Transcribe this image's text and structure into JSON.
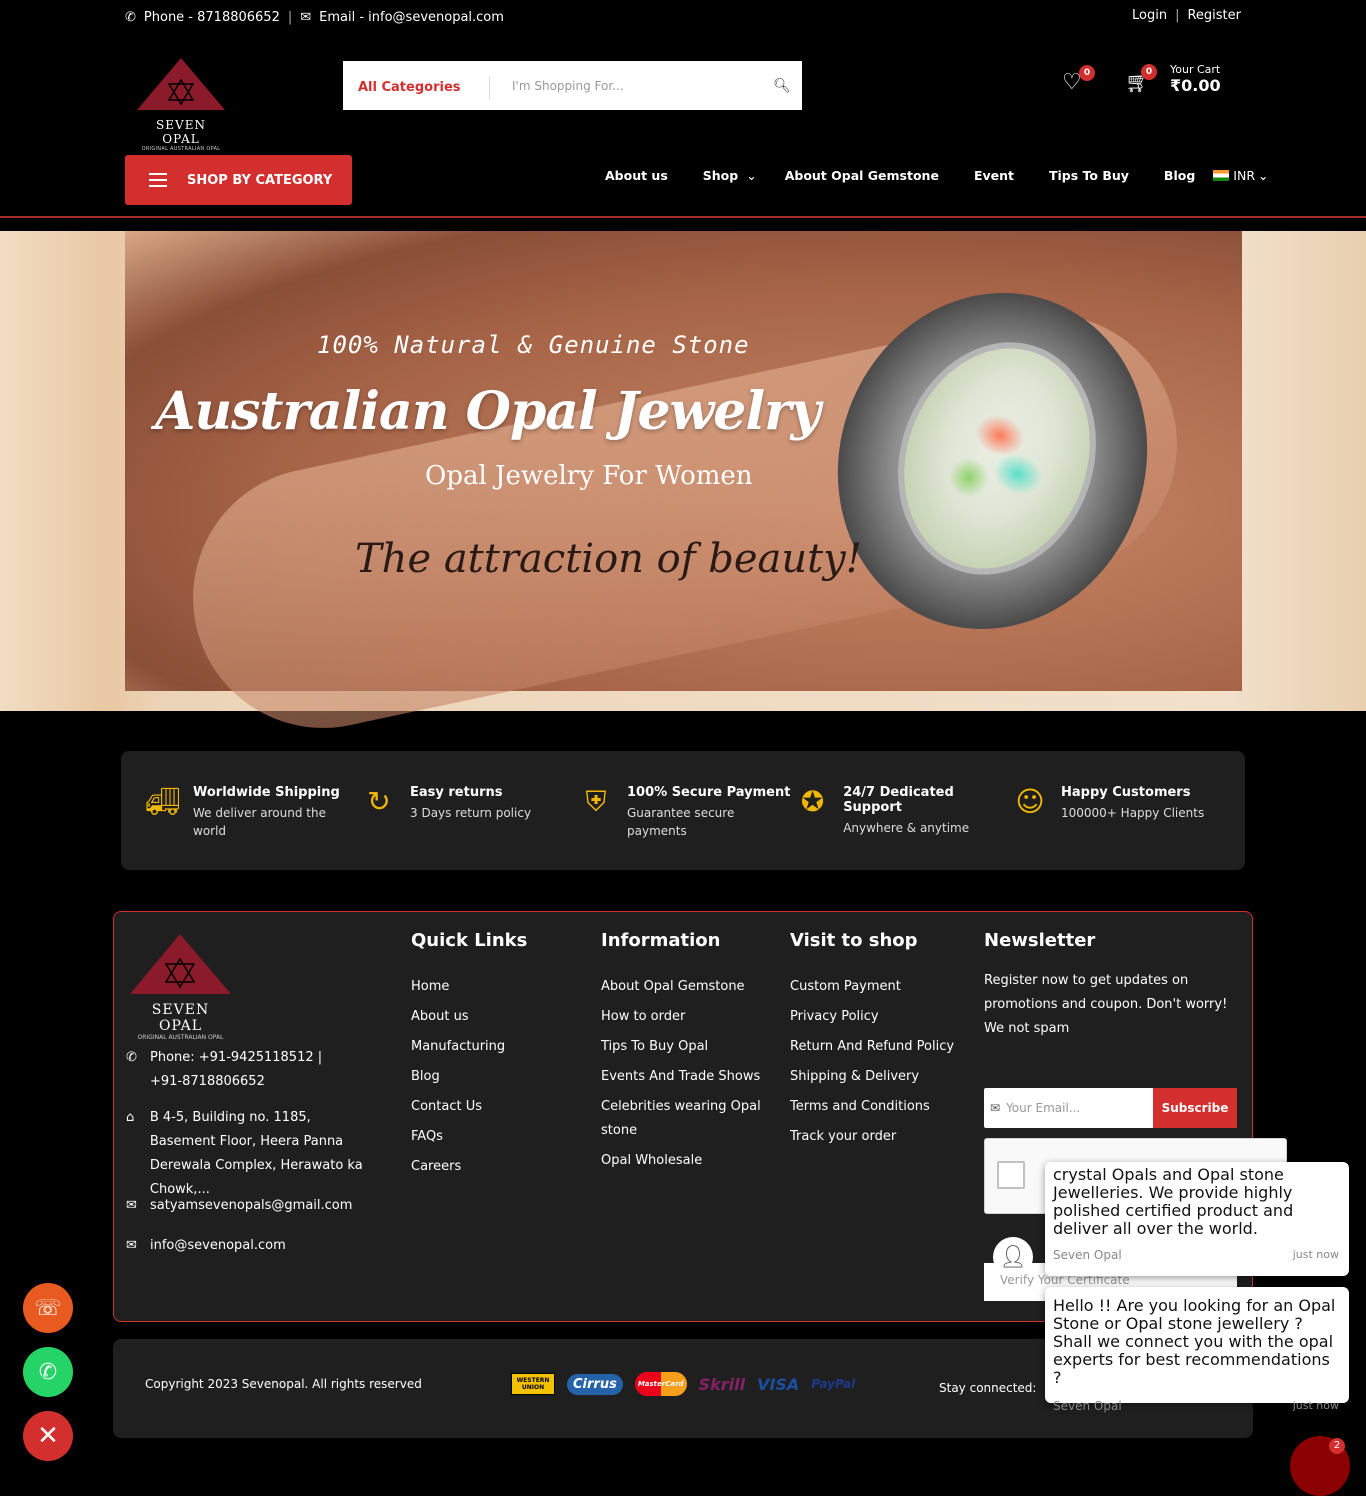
{
  "topbar": {
    "phone": "Phone - 8718806652",
    "email": "Email - info@sevenopal.com",
    "login": "Login",
    "register": "Register"
  },
  "logo": {
    "name": "SEVEN OPAL",
    "tagline": "ORIGINAL AUSTRALIAN OPAL"
  },
  "search": {
    "category": "All Categories",
    "placeholder": "I'm Shopping For..."
  },
  "header": {
    "wishlist_count": "0",
    "cart_count": "0",
    "cart_label": "Your Cart",
    "cart_total": "₹0.00"
  },
  "shop_by_category": "SHOP BY CATEGORY",
  "nav": {
    "items": [
      "About us",
      "Shop",
      "About Opal Gemstone",
      "Event",
      "Tips To Buy",
      "Blog"
    ],
    "currency": "INR"
  },
  "hero": {
    "line1": "100% Natural & Genuine Stone",
    "line2": "Australian Opal Jewelry",
    "line3": "Opal Jewelry For Women",
    "line4": "The attraction of beauty!"
  },
  "features": [
    {
      "title": "Worldwide Shipping",
      "desc": "We deliver around the world",
      "icon": "truck-icon"
    },
    {
      "title": "Easy returns",
      "desc": "3 Days return policy",
      "icon": "return-icon"
    },
    {
      "title": "100% Secure Payment",
      "desc": "Guarantee secure payments",
      "icon": "secure-card-icon"
    },
    {
      "title": "24/7 Dedicated Support",
      "desc": "Anywhere & anytime",
      "icon": "badge-icon"
    },
    {
      "title": "Happy Customers",
      "desc": "100000+ Happy Clients",
      "icon": "smile-icon"
    }
  ],
  "footer": {
    "contact": {
      "phone": "Phone: +91-9425118512 | +91-8718806652",
      "address": "B 4-5, Building no. 1185, Basement Floor, Heera Panna Derewala Complex, Herawato ka Chowk,...",
      "email1": "satyamsevenopals@gmail.com",
      "email2": "info@sevenopal.com"
    },
    "quick_links": {
      "title": "Quick Links",
      "items": [
        "Home",
        "About us",
        "Manufacturing",
        "Blog",
        "Contact Us",
        "FAQs",
        "Careers"
      ]
    },
    "information": {
      "title": "Information",
      "items": [
        "About Opal Gemstone",
        "How to order",
        "Tips To Buy Opal",
        "Events And Trade Shows",
        "Celebrities wearing Opal stone",
        "Opal Wholesale"
      ]
    },
    "visit": {
      "title": "Visit to shop",
      "items": [
        "Custom Payment",
        "Privacy Policy",
        "Return And Refund Policy",
        "Shipping & Delivery",
        "Terms and Conditions",
        "Track your order"
      ]
    },
    "newsletter": {
      "title": "Newsletter",
      "text": "Register now to get updates on promotions and coupon. Don't worry! We not spam",
      "email_placeholder": "Your Email...",
      "subscribe": "Subscribe",
      "verify_placeholder": "Verify Your Certificate"
    }
  },
  "bottom": {
    "copyright": "Copyright 2023 Sevenopal. All rights reserved",
    "payments": [
      "WESTERN UNION",
      "Cirrus",
      "MasterCard",
      "Skrill",
      "VISA",
      "PayPal"
    ],
    "stay": "Stay connected:"
  },
  "chat": {
    "msg1": "crystal Opals and Opal stone Jewelleries. We provide highly polished certified product and deliver all over the world.",
    "msg2": "Hello !! Are you looking for an Opal Stone or Opal stone jewellery ? Shall we connect you with the opal experts for best recommendations ?",
    "sender": "Seven Opal",
    "time": "just now",
    "unread": "2"
  },
  "colors": {
    "accent": "#d32f2f",
    "gold": "#f2b705",
    "panel": "#1f1f1f"
  }
}
